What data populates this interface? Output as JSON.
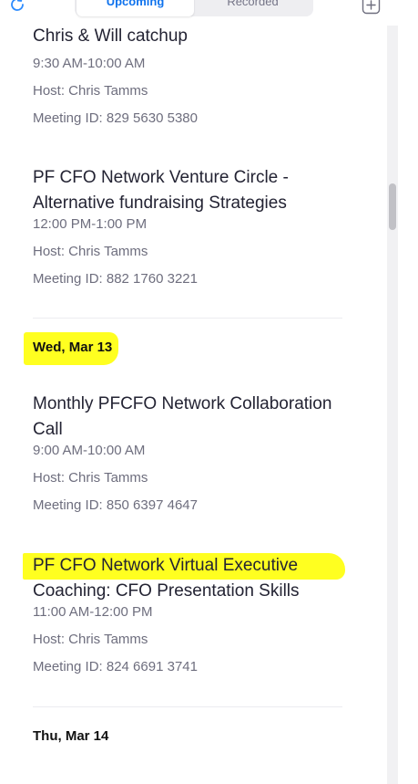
{
  "header": {
    "tabs": [
      {
        "label": "Upcoming",
        "active": true
      },
      {
        "label": "Recorded",
        "active": false
      }
    ],
    "icons": {
      "refresh": "refresh-icon",
      "add": "plus-square-icon"
    },
    "accent_color": "#0e72ed"
  },
  "highlight_color": "#ffff20",
  "meetings": [
    {
      "title_lines": [
        "Chris & Will catchup"
      ],
      "time": "9:30 AM-10:00 AM",
      "host": "Host: Chris Tamms",
      "meeting_id": "Meeting ID: 829 5630 5380"
    },
    {
      "title_lines": [
        "PF CFO Network Venture Circle -",
        "Alternative fundraising Strategies"
      ],
      "time": "12:00 PM-1:00 PM",
      "host": "Host: Chris Tamms",
      "meeting_id": "Meeting ID: 882 1760 3221"
    },
    {
      "title_lines": [
        "Monthly PFCFO Network Collaboration",
        "Call"
      ],
      "time": "9:00 AM-10:00 AM",
      "host": "Host: Chris Tamms",
      "meeting_id": "Meeting ID: 850 6397 4647"
    },
    {
      "title_lines": [
        "PF CFO Network Virtual Executive",
        "Coaching: CFO Presentation Skills"
      ],
      "time": "11:00 AM-12:00 PM",
      "host": "Host: Chris Tamms",
      "meeting_id": "Meeting ID: 824 6691 3741"
    }
  ],
  "date_headers": [
    "Wed, Mar 13",
    "Thu, Mar 14"
  ]
}
